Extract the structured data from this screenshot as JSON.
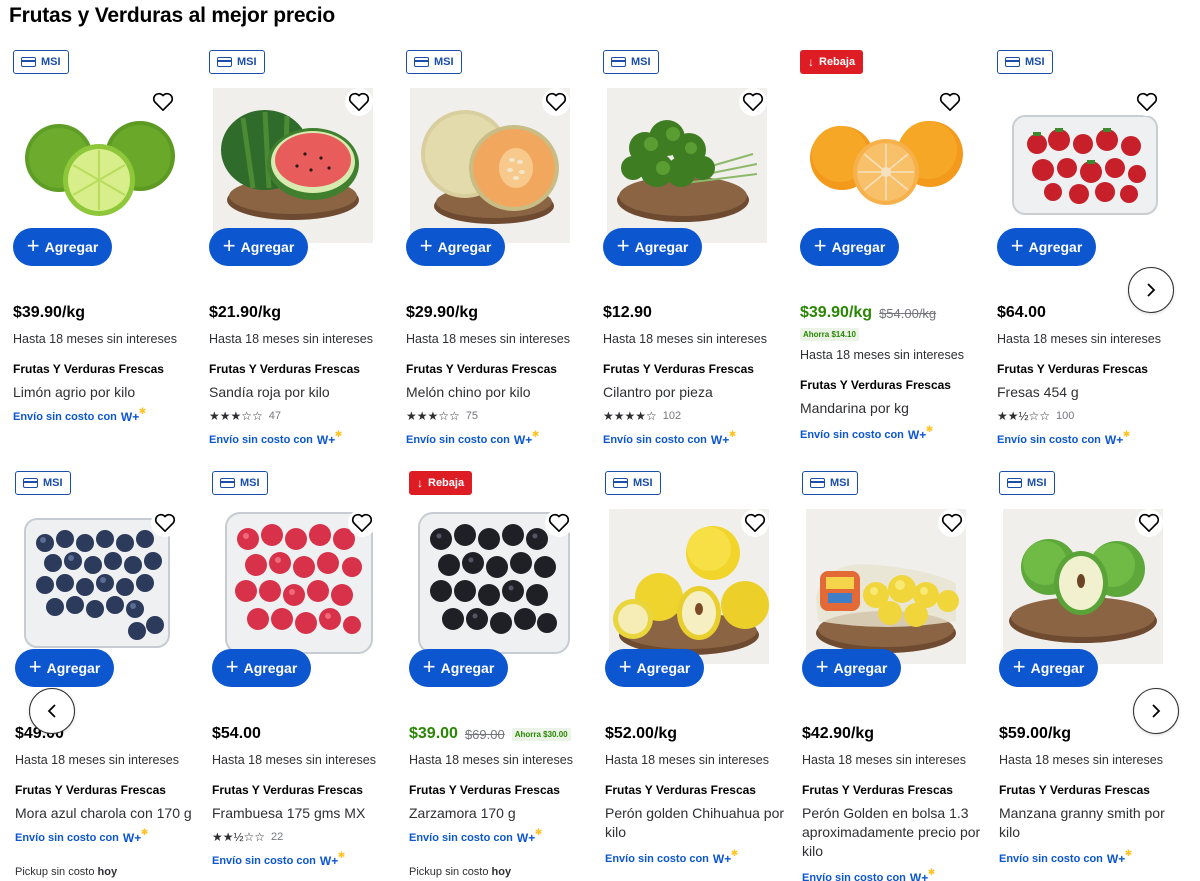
{
  "page": {
    "title": "Frutas y Verduras al mejor precio"
  },
  "labels": {
    "add": "Agregar",
    "msi": "MSI",
    "rebaja": "Rebaja",
    "installments": "Hasta 18 meses sin intereses",
    "shipping": "Envío sin costo con",
    "wplus": "W+",
    "pickup": "Pickup sin costo",
    "pickup_bold": "hoy"
  },
  "colors": {
    "accent": "#0c56d0",
    "sale_green": "#2a8703",
    "rebaja_red": "#de1c24",
    "wplus_star": "#ffc220"
  },
  "products": [
    {
      "badge": "MSI",
      "price": "$39.90/kg",
      "old_price": "",
      "savings": "",
      "brand": "Frutas Y Verduras Frescas",
      "name": "Limón agrio por kilo",
      "rating": null,
      "review_count": "",
      "image": "limon-image",
      "pickup": false
    },
    {
      "badge": "MSI",
      "price": "$21.90/kg",
      "old_price": "",
      "savings": "",
      "brand": "Frutas Y Verduras Frescas",
      "name": "Sandía roja por kilo",
      "rating": "★★★☆☆",
      "review_count": "47",
      "image": "sandia-image",
      "pickup": false
    },
    {
      "badge": "MSI",
      "price": "$29.90/kg",
      "old_price": "",
      "savings": "",
      "brand": "Frutas Y Verduras Frescas",
      "name": "Melón chino por kilo",
      "rating": "★★★☆☆",
      "review_count": "75",
      "image": "melon-image",
      "pickup": false
    },
    {
      "badge": "MSI",
      "price": "$12.90",
      "old_price": "",
      "savings": "",
      "brand": "Frutas Y Verduras Frescas",
      "name": "Cilantro por pieza",
      "rating": "★★★★☆",
      "review_count": "102",
      "image": "cilantro-image",
      "pickup": false
    },
    {
      "badge": "Rebaja",
      "price": "$39.90/kg",
      "old_price": "$54.00/kg",
      "savings": "Ahorra $14.10",
      "brand": "Frutas Y Verduras Frescas",
      "name": "Mandarina por kg",
      "rating": null,
      "review_count": "",
      "image": "mandarina-image",
      "pickup": false
    },
    {
      "badge": "MSI",
      "price": "$64.00",
      "old_price": "",
      "savings": "",
      "brand": "Frutas Y Verduras Frescas",
      "name": "Fresas 454 g",
      "rating": "★★½☆☆",
      "review_count": "100",
      "image": "fresas-image",
      "pickup": false
    },
    {
      "badge": "MSI",
      "price": "$49.00",
      "old_price": "",
      "savings": "",
      "brand": "Frutas Y Verduras Frescas",
      "name": "Mora azul charola con 170 g",
      "rating": null,
      "review_count": "",
      "image": "mora-image",
      "pickup": true
    },
    {
      "badge": "MSI",
      "price": "$54.00",
      "old_price": "",
      "savings": "",
      "brand": "Frutas Y Verduras Frescas",
      "name": "Frambuesa 175 gms MX",
      "rating": "★★½☆☆",
      "review_count": "22",
      "image": "frambuesa-image",
      "pickup": false
    },
    {
      "badge": "Rebaja",
      "price": "$39.00",
      "old_price": "$69.00",
      "savings": "Ahorra $30.00",
      "brand": "Frutas Y Verduras Frescas",
      "name": "Zarzamora 170 g",
      "rating": null,
      "review_count": "",
      "image": "zarzamora-image",
      "pickup": true
    },
    {
      "badge": "MSI",
      "price": "$52.00/kg",
      "old_price": "",
      "savings": "",
      "brand": "Frutas Y Verduras Frescas",
      "name": "Perón golden Chihuahua por kilo",
      "rating": null,
      "review_count": "",
      "image": "peron-image",
      "pickup": false
    },
    {
      "badge": "MSI",
      "price": "$42.90/kg",
      "old_price": "",
      "savings": "",
      "brand": "Frutas Y Verduras Frescas",
      "name": "Perón Golden en bolsa 1.3 aproximadamente precio por kilo",
      "rating": null,
      "review_count": "",
      "image": "peron-bolsa-image",
      "pickup": false
    },
    {
      "badge": "MSI",
      "price": "$59.00/kg",
      "old_price": "",
      "savings": "",
      "brand": "Frutas Y Verduras Frescas",
      "name": "Manzana granny smith por kilo",
      "rating": null,
      "review_count": "",
      "image": "manzana-verde-image",
      "pickup": false
    }
  ]
}
